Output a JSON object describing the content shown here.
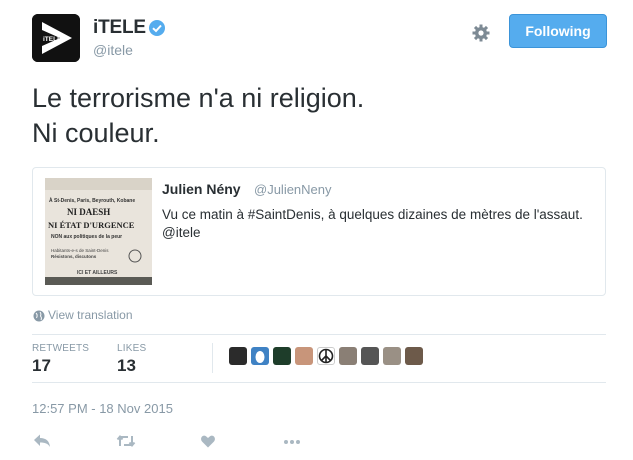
{
  "account": {
    "name": "iTELE",
    "handle": "@itele",
    "avatar_text": "iTELE"
  },
  "header": {
    "follow_label": "Following"
  },
  "tweet": {
    "text": "Le terrorisme n'a ni religion.\nNi couleur."
  },
  "quote": {
    "name": "Julien Nény",
    "handle": "@JulienNeny",
    "text": "Vu ce matin à #SaintDenis, à quelques dizaines de mètres de l'assaut. @itele",
    "image_lines": [
      "À St-Denis, Paris, Beyrouth, Kobane",
      "NI DAESH",
      "NI ÉTAT D'URGENCE",
      "NON aux politiques de la peur",
      "Habitants-e-s de Saint-Denis",
      "Résistons, discutons",
      "ICI ET AILLEURS"
    ]
  },
  "translation_label": "View translation",
  "stats": {
    "retweets_label": "RETWEETS",
    "retweets": "17",
    "likes_label": "LIKES",
    "likes": "13"
  },
  "likers": [
    "#2b2b2b",
    "#3f82c4",
    "#1e3d2a",
    "#c8957a",
    "#ffffff",
    "#8a7f75",
    "#555555",
    "#9a9085",
    "#6d5a4a"
  ],
  "timestamp": "12:57 PM - 18 Nov 2015",
  "actions": [
    "reply-icon",
    "retweet-icon",
    "like-icon",
    "more-icon"
  ],
  "colors": {
    "accent": "#55acee",
    "muted": "#8899a6",
    "text": "#292f33",
    "border": "#e1e8ed"
  }
}
